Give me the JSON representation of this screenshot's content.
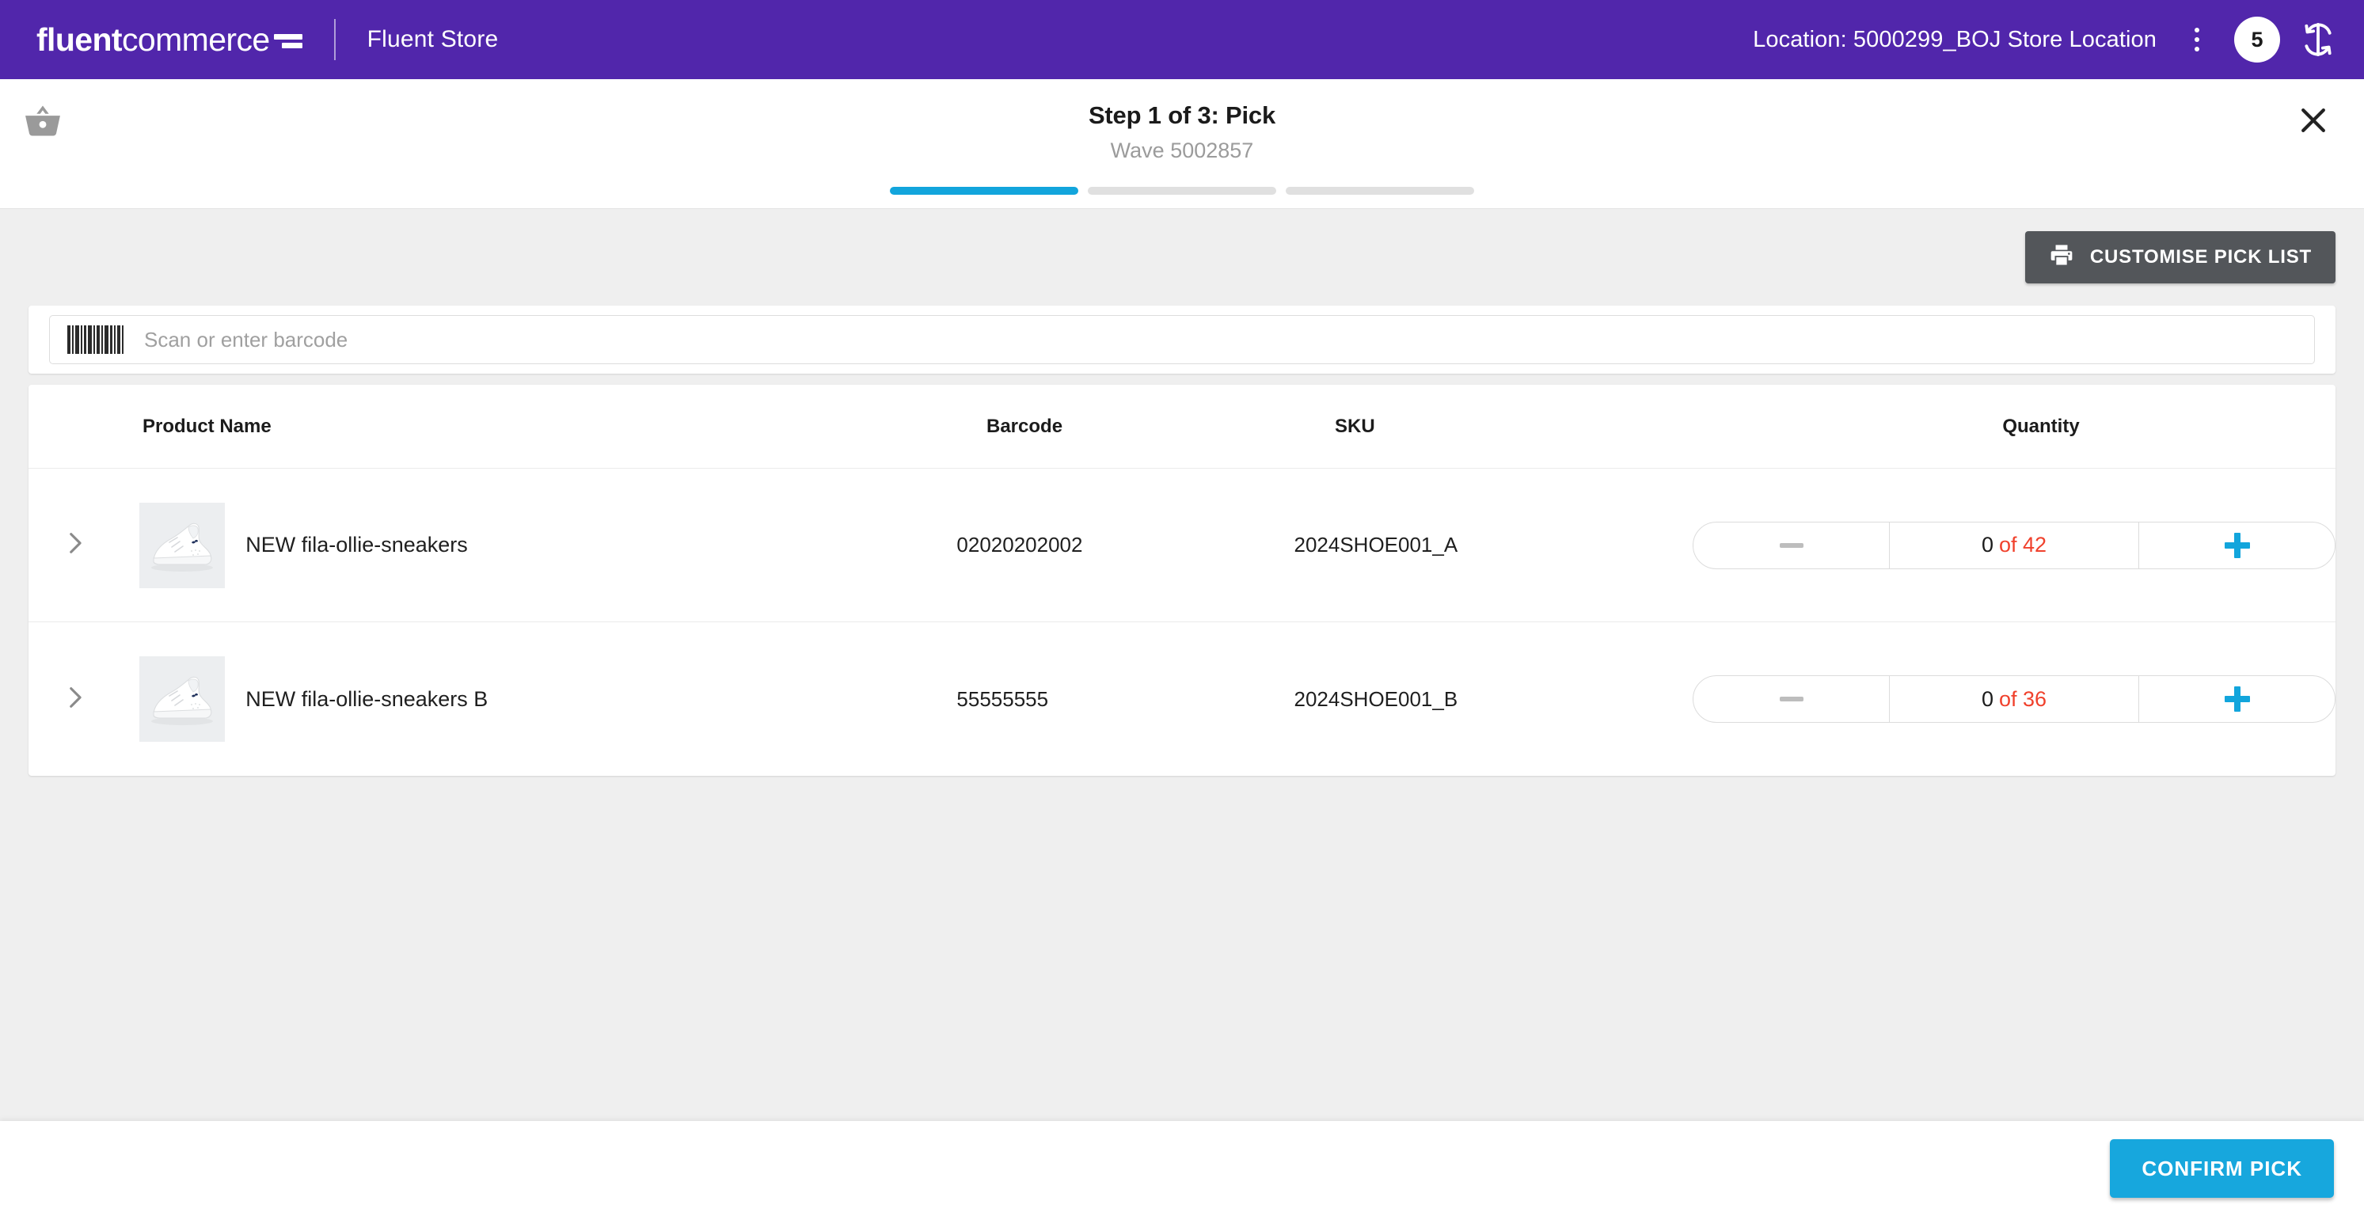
{
  "header": {
    "logo_text_bold": "fluent",
    "logo_text_light": "commerce",
    "logo_icon": "fluentcommerce-mark-icon",
    "app_name": "Fluent Store",
    "location_label": "Location: 5000299_BOJ Store Location",
    "kebab_icon": "more-vertical-icon",
    "notification_count": "5",
    "sync_icon": "sync-refresh-icon",
    "bar_color": "#5126AB"
  },
  "step": {
    "basket_icon": "shopping-basket-icon",
    "title": "Step 1 of 3: Pick",
    "subtitle": "Wave 5002857",
    "close_icon": "close-icon",
    "progress": [
      {
        "state": "active"
      },
      {
        "state": "inactive"
      },
      {
        "state": "inactive"
      }
    ],
    "active_color": "#12A5DC",
    "inactive_color": "#E0E0E0"
  },
  "toolbar": {
    "customise_label": "CUSTOMISE PICK LIST",
    "printer_icon": "printer-icon",
    "button_color": "#53565A"
  },
  "scan": {
    "barcode_icon": "barcode-icon",
    "placeholder": "Scan or enter barcode",
    "value": ""
  },
  "table": {
    "columns": [
      "Product Name",
      "Barcode",
      "SKU",
      "Quantity"
    ],
    "rows": [
      {
        "expand_icon": "chevron-right-icon",
        "thumbnail_icon": "sneaker-product-image",
        "product_name": "NEW fila-ollie-sneakers",
        "barcode": "02020202002",
        "sku": "2024SHOE001_A",
        "qty_picked": "0",
        "qty_of": "of 42",
        "minus_icon": "minus-icon",
        "plus_icon": "plus-icon"
      },
      {
        "expand_icon": "chevron-right-icon",
        "thumbnail_icon": "sneaker-product-image",
        "product_name": "NEW fila-ollie-sneakers B",
        "barcode": "55555555",
        "sku": "2024SHOE001_B",
        "qty_picked": "0",
        "qty_of": "of 36",
        "minus_icon": "minus-icon",
        "plus_icon": "plus-icon"
      }
    ],
    "qty_remaining_color": "#F0412C"
  },
  "footer": {
    "confirm_label": "CONFIRM PICK",
    "confirm_color": "#17A7DD"
  }
}
